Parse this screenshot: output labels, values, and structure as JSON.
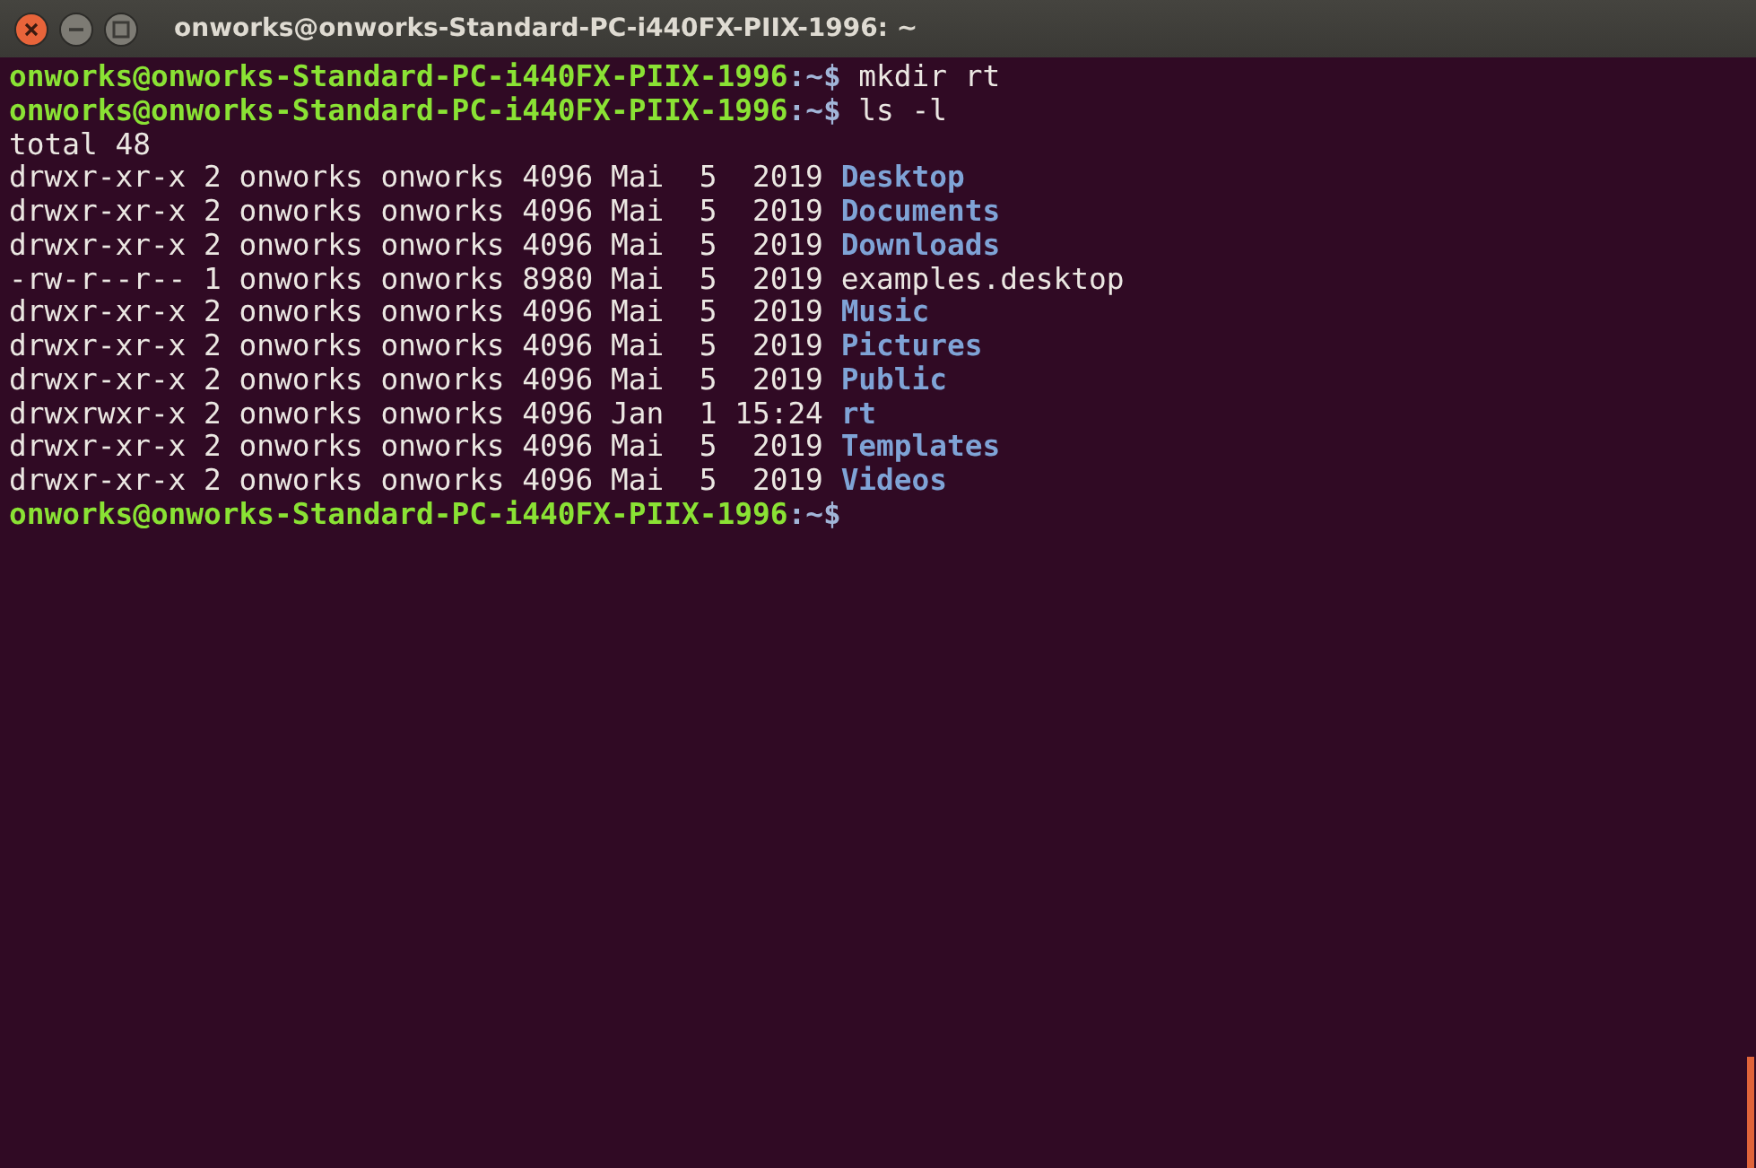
{
  "window": {
    "title": "onworks@onworks-Standard-PC-i440FX-PIIX-1996: ~"
  },
  "terminal": {
    "lines": [
      {
        "kind": "prompt",
        "user_host": "onworks@onworks-Standard-PC-i440FX-PIIX-1996",
        "path": ":~$",
        "command": "mkdir rt"
      },
      {
        "kind": "prompt",
        "user_host": "onworks@onworks-Standard-PC-i440FX-PIIX-1996",
        "path": ":~$",
        "command": "ls -l"
      },
      {
        "kind": "text",
        "text": "total 48"
      },
      {
        "kind": "entry",
        "meta": "drwxr-xr-x 2 onworks onworks 4096 Mai  5  2019",
        "name": "Desktop",
        "directory": true
      },
      {
        "kind": "entry",
        "meta": "drwxr-xr-x 2 onworks onworks 4096 Mai  5  2019",
        "name": "Documents",
        "directory": true
      },
      {
        "kind": "entry",
        "meta": "drwxr-xr-x 2 onworks onworks 4096 Mai  5  2019",
        "name": "Downloads",
        "directory": true
      },
      {
        "kind": "entry",
        "meta": "-rw-r--r-- 1 onworks onworks 8980 Mai  5  2019",
        "name": "examples.desktop",
        "directory": false
      },
      {
        "kind": "entry",
        "meta": "drwxr-xr-x 2 onworks onworks 4096 Mai  5  2019",
        "name": "Music",
        "directory": true
      },
      {
        "kind": "entry",
        "meta": "drwxr-xr-x 2 onworks onworks 4096 Mai  5  2019",
        "name": "Pictures",
        "directory": true
      },
      {
        "kind": "entry",
        "meta": "drwxr-xr-x 2 onworks onworks 4096 Mai  5  2019",
        "name": "Public",
        "directory": true
      },
      {
        "kind": "entry",
        "meta": "drwxrwxr-x 2 onworks onworks 4096 Jan  1 15:24",
        "name": "rt",
        "directory": true
      },
      {
        "kind": "entry",
        "meta": "drwxr-xr-x 2 onworks onworks 4096 Mai  5  2019",
        "name": "Templates",
        "directory": true
      },
      {
        "kind": "entry",
        "meta": "drwxr-xr-x 2 onworks onworks 4096 Mai  5  2019",
        "name": "Videos",
        "directory": true
      },
      {
        "kind": "prompt",
        "user_host": "onworks@onworks-Standard-PC-i440FX-PIIX-1996",
        "path": ":~$"
      }
    ]
  }
}
